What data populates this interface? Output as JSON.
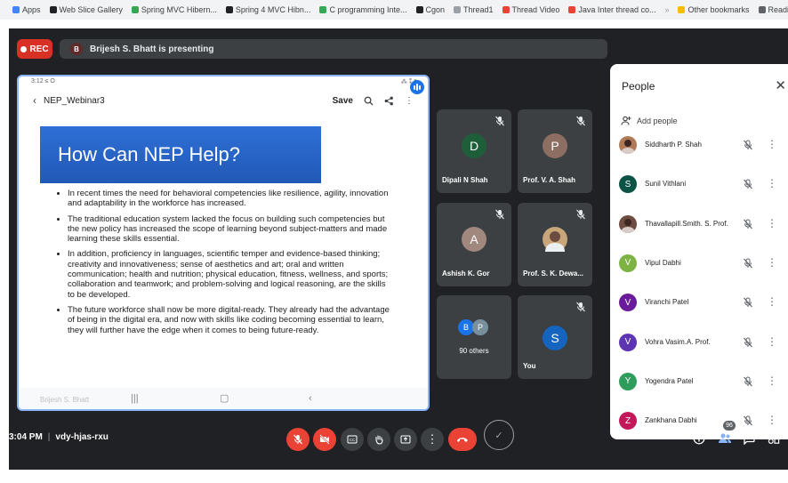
{
  "bookmarks": [
    {
      "label": "Apps",
      "color": "#4285f4"
    },
    {
      "label": "Web Slice Gallery",
      "color": "#202124"
    },
    {
      "label": "Spring MVC Hibern...",
      "color": "#34a853"
    },
    {
      "label": "Spring 4 MVC Hibn...",
      "color": "#202124"
    },
    {
      "label": "C programming Inte...",
      "color": "#34a853"
    },
    {
      "label": "Cgon",
      "color": "#202124"
    },
    {
      "label": "Thread1",
      "color": "#9aa0a6"
    },
    {
      "label": "Thread Video",
      "color": "#ea4335"
    },
    {
      "label": "Java Inter thread co...",
      "color": "#ea4335"
    }
  ],
  "bookmarks_more": "»",
  "other_bookmarks": "Other bookmarks",
  "reading_list": "Reading list",
  "rec_label": "REC",
  "presenter": {
    "initial": "B",
    "text": "Brijesh S. Bhatt is presenting"
  },
  "share": {
    "status_time": "3:12 ≤ O",
    "status_icons": "⁂ ⁑ ▮",
    "doc_title": "NEP_Webinar3",
    "save_label": "Save",
    "slide_title": "How Can NEP Help?",
    "bullets": [
      "In recent times the need for behavioral competencies like resilience, agility, innovation and adaptability in the workforce has increased.",
      "The traditional education system lacked the focus on building such competencies but the new policy has increased the scope of learning beyond subject-matters and made learning these skills essential.",
      "In addition, proficiency in languages, scientific temper and evidence-based thinking; creativity and innovativeness; sense of aesthetics and art; oral and written communication; health and nutrition; physical education, fitness, wellness, and sports; collaboration and teamwork; and problem-solving and logical reasoning, are the skills to be developed.",
      "The future workforce shall now be more digital-ready. They already had the advantage of being in the digital era, and now with skills like coding becoming essential to learn, they will further have the edge when it comes to being future-ready."
    ],
    "presenter_tag": "Brijesh S. Bhatt"
  },
  "tiles": [
    {
      "name": "Dipali N Shah",
      "initial": "D",
      "color": "#1e5f3a"
    },
    {
      "name": "Prof. V. A. Shah",
      "initial": "P",
      "color": "#8d6e63"
    },
    {
      "name": "Ashish K. Gor",
      "initial": "A",
      "color": "#a1887f"
    },
    {
      "name": "Prof. S. K. Dewa...",
      "initial": "",
      "color": "#c9a57a"
    },
    {
      "name": "90 others",
      "initials": [
        "B",
        "P"
      ],
      "colors": [
        "#1a73e8",
        "#78909c"
      ]
    },
    {
      "name": "You",
      "initial": "S",
      "color": "#1565c0"
    }
  ],
  "people": {
    "title": "People",
    "close": "✕",
    "add_label": "Add people",
    "list": [
      {
        "name": "Siddharth P. Shah",
        "initial": "",
        "color": "#b07a56"
      },
      {
        "name": "Sunil Vithlani",
        "initial": "S",
        "color": "#0b5345"
      },
      {
        "name": "Thavallapill.Smith. S. Prof.",
        "initial": "",
        "color": "#6d4c41"
      },
      {
        "name": "Vipul Dabhi",
        "initial": "V",
        "color": "#7cb342"
      },
      {
        "name": "Viranchi Patel",
        "initial": "V",
        "color": "#6a1b9a"
      },
      {
        "name": "Vohra Vasim.A. Prof.",
        "initial": "V",
        "color": "#5e35b1"
      },
      {
        "name": "Yogendra Patel",
        "initial": "Y",
        "color": "#2e9c5b"
      },
      {
        "name": "Zankhana Dabhi",
        "initial": "Z",
        "color": "#c2185b"
      }
    ]
  },
  "meeting": {
    "time": "3:04 PM",
    "code": "vdy-hjas-rxu"
  },
  "participant_count": "96"
}
